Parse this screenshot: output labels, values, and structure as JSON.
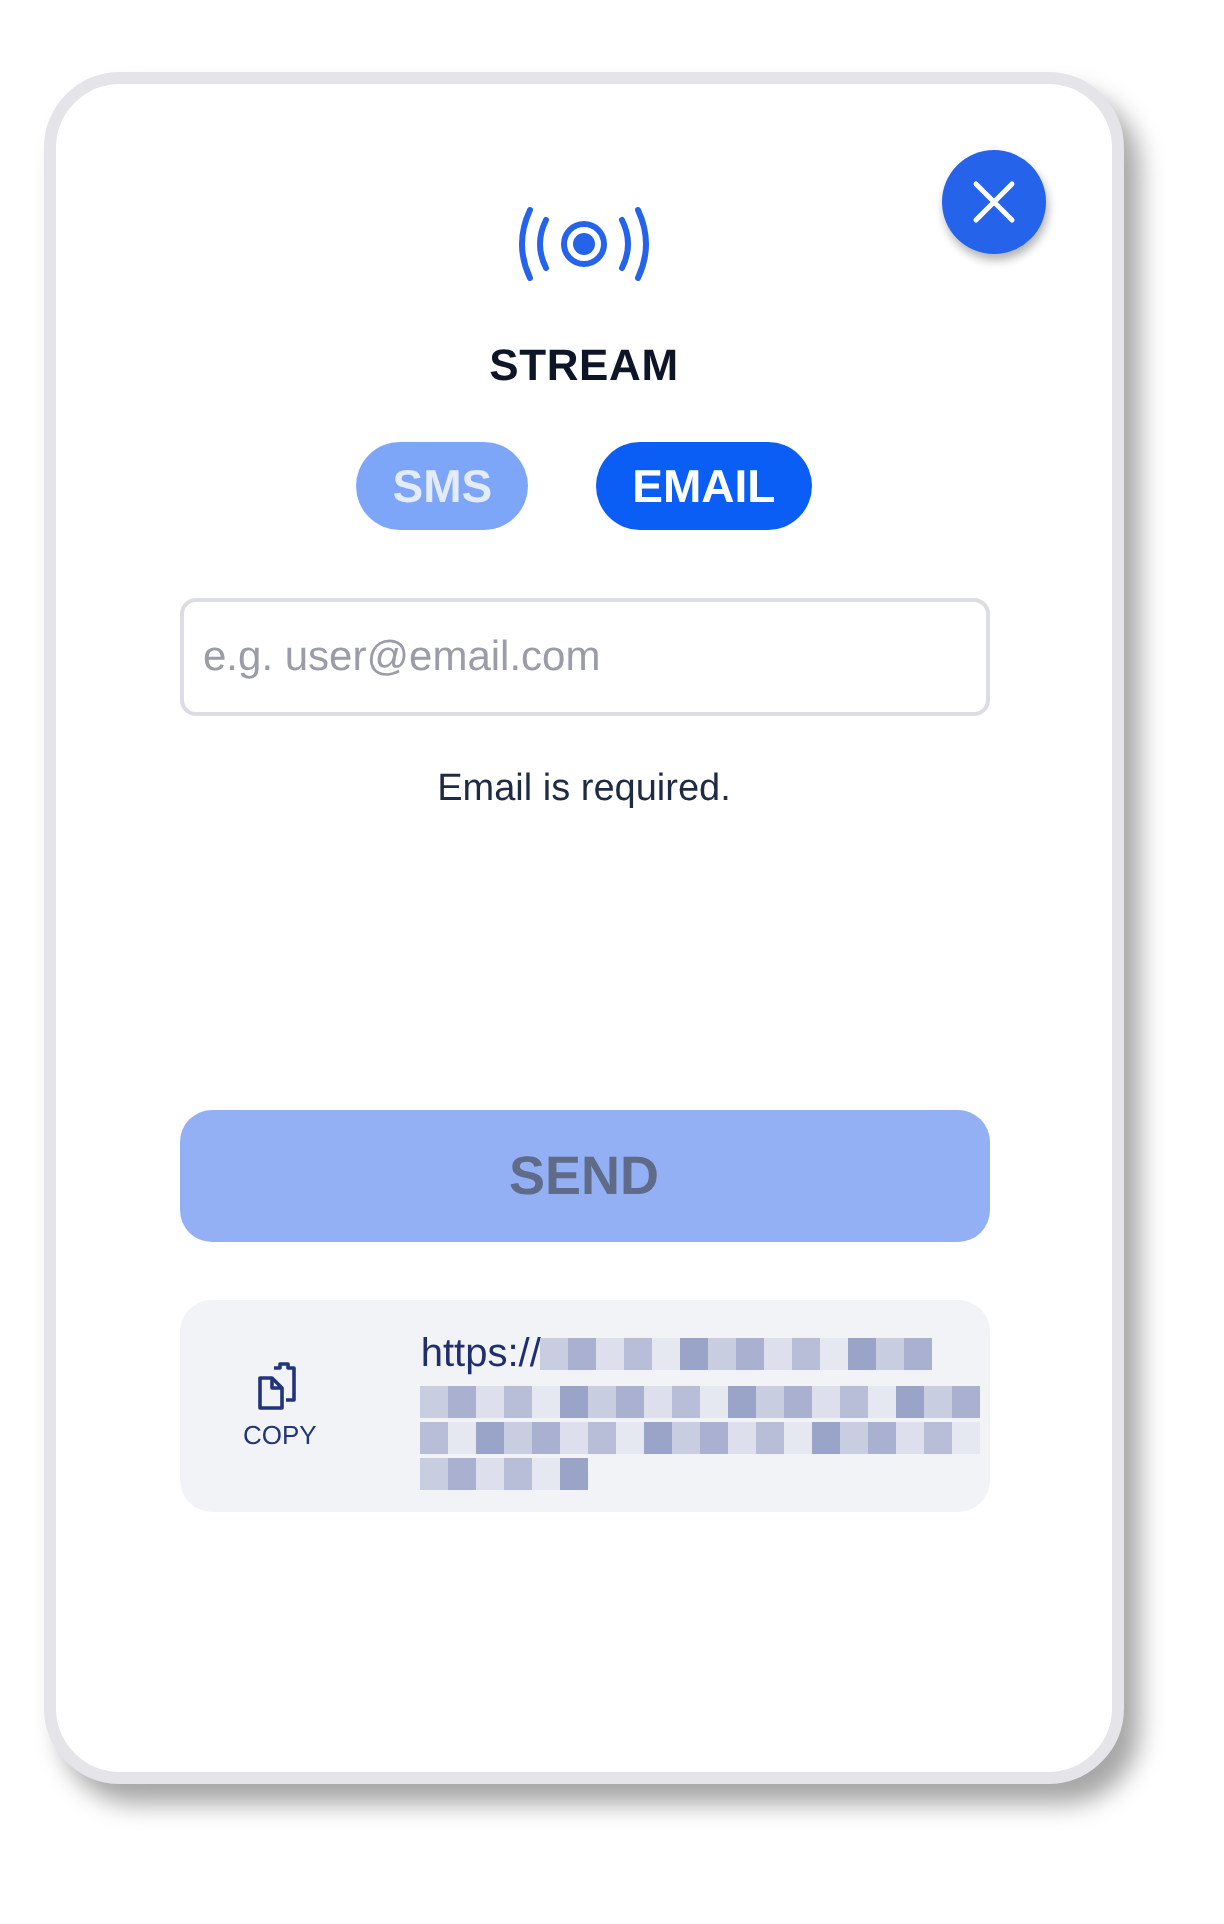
{
  "title": "STREAM",
  "tabs": [
    {
      "label": "SMS",
      "selected": false
    },
    {
      "label": "EMAIL",
      "selected": true
    }
  ],
  "email_field": {
    "placeholder": "e.g. user@email.com"
  },
  "error": "Email is required.",
  "send_button": {
    "label": "SEND",
    "disabled": true
  },
  "link_panel": {
    "copy_label": "COPY",
    "url": "https://"
  }
}
